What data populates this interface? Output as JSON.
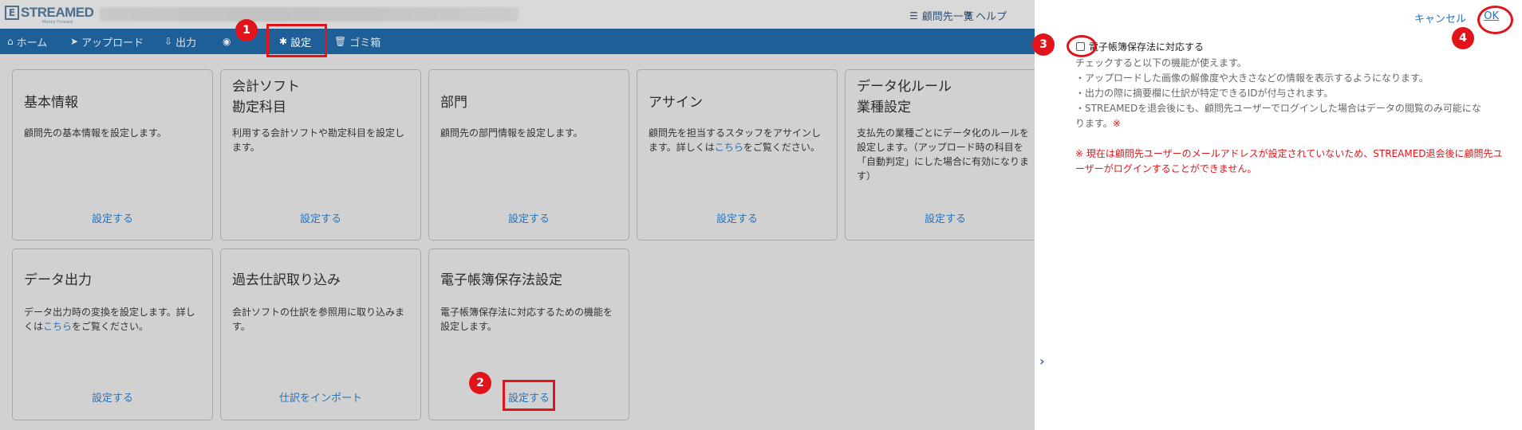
{
  "header": {
    "logo_text": "STREAMED",
    "logo_mark": "E",
    "logo_sub": "Money Forward",
    "client_list": "顧問先一覧",
    "help": "ヘルプ"
  },
  "nav": {
    "home": "ホーム",
    "upload": "アップロード",
    "output": "出力",
    "hidden": "",
    "settings": "設定",
    "trash": "ゴミ箱"
  },
  "cards": [
    {
      "title1": "基本情報",
      "title2": "",
      "desc": "顧問先の基本情報を設定します。",
      "action": "設定する"
    },
    {
      "title1": "会計ソフト",
      "title2": "勘定科目",
      "desc": "利用する会計ソフトや勘定科目を設定します。",
      "action": "設定する"
    },
    {
      "title1": "部門",
      "title2": "",
      "desc": "顧問先の部門情報を設定します。",
      "action": "設定する"
    },
    {
      "title1": "アサイン",
      "title2": "",
      "desc_pre": "顧問先を担当するスタッフをアサインします。詳しくは",
      "desc_link": "こちら",
      "desc_post": "をご覧ください。",
      "action": "設定する"
    },
    {
      "title1": "データ化ルール",
      "title2": "業種設定",
      "desc": "支払先の業種ごとにデータ化のルールを設定します。（アップロード時の科目を「自動判定」にした場合に有効になります）",
      "action": "設定する"
    },
    {
      "title1": "データ出力",
      "title2": "",
      "desc_pre": "データ出力時の変換を設定します。詳しくは",
      "desc_link": "こちら",
      "desc_post": "をご覧ください。",
      "action": "設定する"
    },
    {
      "title1": "過去仕訳取り込み",
      "title2": "",
      "desc": "会計ソフトの仕訳を参照用に取り込みます。",
      "action": "仕訳をインポート"
    },
    {
      "title1": "電子帳簿保存法設定",
      "title2": "",
      "desc": "電子帳簿保存法に対応するための機能を設定します。",
      "action": "設定する"
    }
  ],
  "panel": {
    "cancel": "キャンセル",
    "ok": "OK",
    "checkbox_label": "電子帳簿保存法に対応する",
    "lines": [
      "チェックすると以下の機能が使えます。",
      "・アップロードした画像の解像度や大きさなどの情報を表示するようになります。",
      "・出力の際に摘要欄に仕訳が特定できるIDが付与されます。",
      "・STREAMEDを退会後にも、顧問先ユーザーでログインした場合はデータの閲覧のみ可能にな"
    ],
    "last_line": "ります。",
    "asterisk": "※",
    "warning": "※ 現在は顧問先ユーザーのメールアドレスが設定されていないため、STREAMED退会後に顧問先ユーザーがログインすることができません。"
  },
  "annotations": [
    "1",
    "2",
    "3",
    "4"
  ],
  "icons": {
    "list": "list-icon",
    "help": "question-icon",
    "home": "home-icon",
    "upload": "paper-plane-icon",
    "output": "download-icon",
    "eye": "eye-icon",
    "gear": "gear-icon",
    "trash": "trash-icon",
    "chevron": "chevron-right-icon"
  },
  "colors": {
    "nav": "#1f5f97",
    "link": "#2a73b8",
    "annotation": "#e0141a"
  }
}
